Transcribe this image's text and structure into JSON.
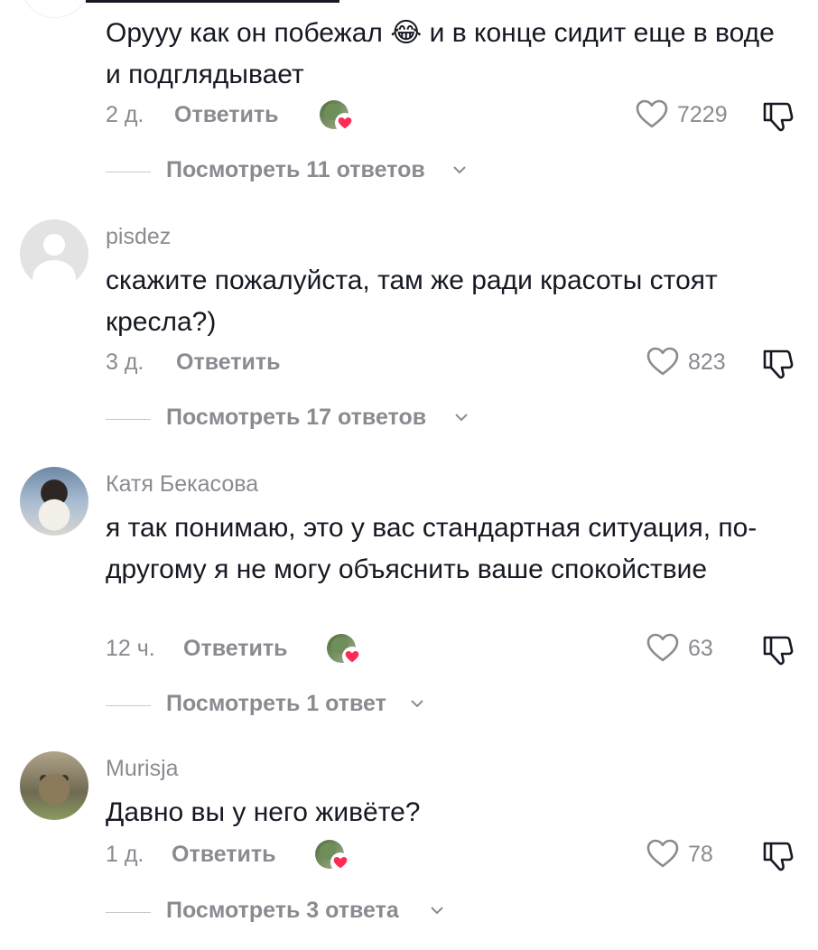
{
  "comments": [
    {
      "username": "",
      "text": "Орууу как он побежал 😂 и в конце сидит еще в воде и подглядывает",
      "time": "2 д.",
      "reply_label": "Ответить",
      "likes": "7229",
      "creator_liked": true,
      "view_replies": "Посмотреть 11 ответов"
    },
    {
      "username": "pisdez",
      "text": "скажите пожалуйста, там же ради красоты стоят кресла?)",
      "time": "3 д.",
      "reply_label": "Ответить",
      "likes": "823",
      "creator_liked": false,
      "view_replies": "Посмотреть 17 ответов"
    },
    {
      "username": "Катя Бекасова",
      "text": "я так понимаю, это у вас стандартная ситуация, по-другому я не могу объяснить ваше спокойствие",
      "time": "12 ч.",
      "reply_label": "Ответить",
      "likes": "63",
      "creator_liked": true,
      "view_replies": "Посмотреть 1 ответ"
    },
    {
      "username": "Murisja",
      "text": "Давно вы у него живёте?",
      "time": "1 д.",
      "reply_label": "Ответить",
      "likes": "78",
      "creator_liked": true,
      "view_replies": "Посмотреть 3 ответа"
    }
  ],
  "icons": {
    "like": "heart-outline-icon",
    "dislike": "thumbs-down-icon",
    "expand": "chevron-down-icon",
    "creator_like": "creator-heart-badge-icon"
  },
  "colors": {
    "text": "#161823",
    "secondary": "#8a8b91",
    "heart_badge": "#fe2c55"
  }
}
